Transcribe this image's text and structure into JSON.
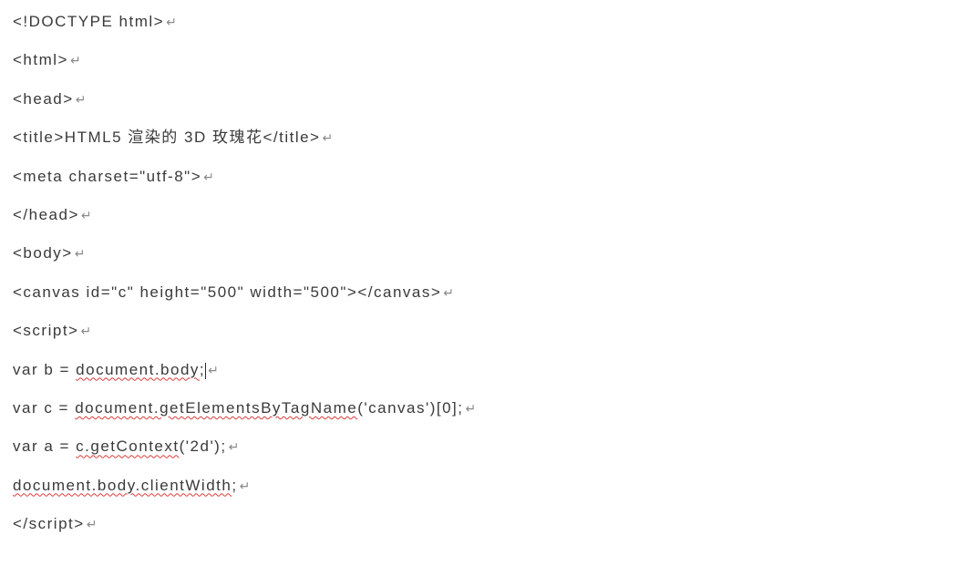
{
  "pilcrow": "↵",
  "lines": {
    "l1": {
      "t1": "<!DOCTYPE html>"
    },
    "l2": {
      "t1": "<html>"
    },
    "l3": {
      "t1": "<head>"
    },
    "l4": {
      "t1": "<title>HTML5 渲染的 3D 玫瑰花</title>"
    },
    "l5": {
      "t1": "<meta charset=\"utf-8\">"
    },
    "l6": {
      "t1": "</head>"
    },
    "l7": {
      "t1": "<body>"
    },
    "l8": {
      "t1": "<canvas id=\"c\" height=\"500\" width=\"500\"></canvas>"
    },
    "l9": {
      "t1": "<script>"
    },
    "l10": {
      "t1": "var b = ",
      "s1": "document.body",
      "t2": ";"
    },
    "l11": {
      "t1": "var c = ",
      "s1": "document.getElementsByTagName",
      "t2": "('canvas')[0];"
    },
    "l12": {
      "t1": "var a = ",
      "s1": "c.getContext",
      "t2": "('2d');"
    },
    "l13": {
      "s1": "document.body.clientWidth",
      "t1": ";"
    },
    "l14": {
      "t1": "</script>"
    }
  }
}
